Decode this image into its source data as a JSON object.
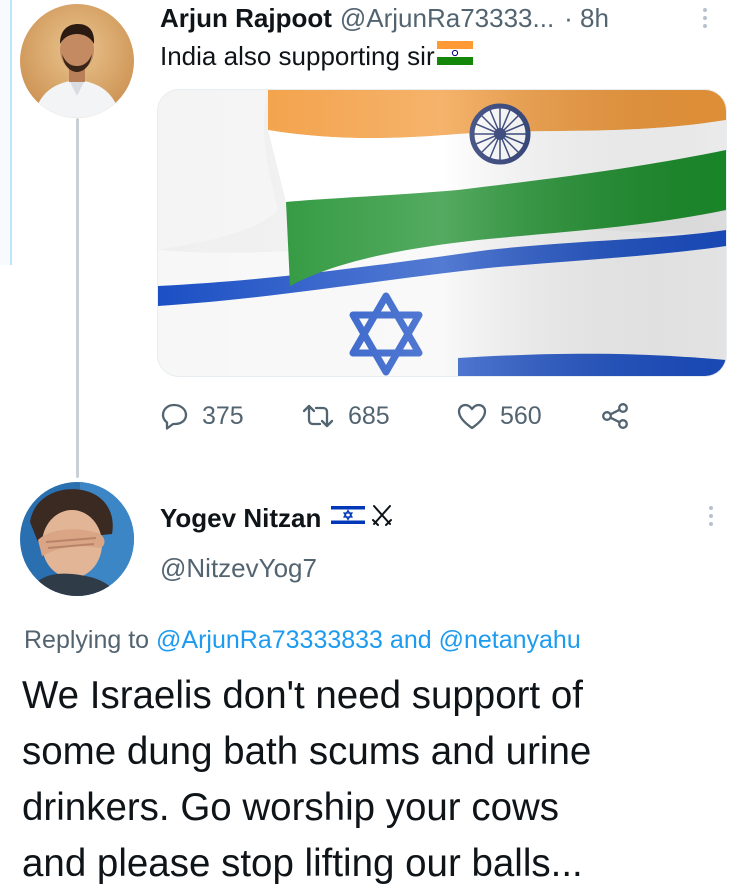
{
  "tweet1": {
    "display_name": "Arjun Rajpoot",
    "handle": "@ArjunRa73333...",
    "time": "· 8h",
    "text": "India also supporting sir",
    "avatar_icon": "person-photo-icon",
    "image_icon": "india-israel-flags-image",
    "actions": {
      "replies": "375",
      "retweets": "685",
      "likes": "560"
    }
  },
  "tweet2": {
    "display_name": "Yogev Nitzan",
    "handle": "@NitzevYog7",
    "replying_prefix": "Replying to",
    "mention1": "@ArjunRa73333833",
    "replying_and": "and",
    "mention2": "@netanyahu",
    "body_lines": [
      "We Israelis don't need support of",
      "some dung bath scums and urine",
      "drinkers. Go worship your cows",
      "and please stop lifting our balls..."
    ],
    "avatar_icon": "person-covering-face-photo-icon"
  },
  "colors": {
    "link": "#1d9bf0",
    "secondary_text": "#536471",
    "primary_text": "#0f1419",
    "saffron": "#ff9933",
    "india_green": "#138808",
    "israel_blue": "#0038b8"
  }
}
